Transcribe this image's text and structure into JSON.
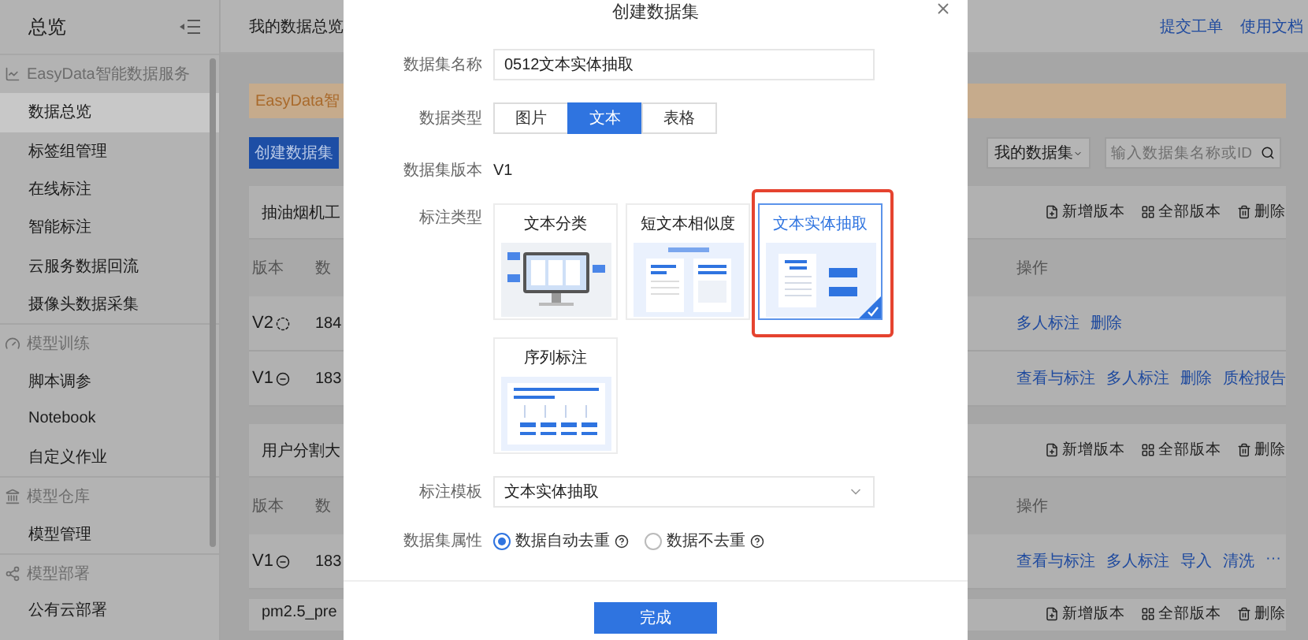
{
  "sidebar": {
    "title": "总览",
    "groups": [
      {
        "label": "EasyData智能数据服务",
        "items": [
          {
            "label": "数据总览",
            "selected": true
          },
          {
            "label": "标签组管理",
            "selected": false
          },
          {
            "label": "在线标注",
            "selected": false
          },
          {
            "label": "智能标注",
            "selected": false
          },
          {
            "label": "云服务数据回流",
            "selected": false
          },
          {
            "label": "摄像头数据采集",
            "selected": false
          }
        ]
      },
      {
        "label": "模型训练",
        "items": [
          {
            "label": "脚本调参",
            "selected": false
          },
          {
            "label": "Notebook",
            "selected": false
          },
          {
            "label": "自定义作业",
            "selected": false
          }
        ]
      },
      {
        "label": "模型仓库",
        "items": [
          {
            "label": "模型管理",
            "selected": false
          }
        ]
      },
      {
        "label": "模型部署",
        "items": [
          {
            "label": "公有云部署",
            "selected": false
          }
        ]
      }
    ]
  },
  "topbar": {
    "title": "我的数据总览",
    "links": [
      "提交工单",
      "使用文档"
    ]
  },
  "banner": {
    "text": "EasyData智"
  },
  "create_button": "创建数据集",
  "filter": {
    "dropdown": "我的数据集",
    "search_placeholder": "输入数据集名称或ID"
  },
  "datasets": [
    {
      "name": "抽油烟机工",
      "actions": [
        "新增版本",
        "全部版本",
        "删除"
      ],
      "columns": [
        "版本",
        "数",
        "操作"
      ],
      "rows": [
        {
          "version": "V2",
          "kind": "pending",
          "count": "184",
          "operations": [
            "多人标注",
            "删除"
          ]
        },
        {
          "version": "V1",
          "kind": "done",
          "count": "183",
          "operations": [
            "查看与标注",
            "多人标注",
            "删除",
            "质检报告"
          ]
        }
      ]
    },
    {
      "name": "用户分割大",
      "actions": [
        "新增版本",
        "全部版本",
        "删除"
      ],
      "columns": [
        "版本",
        "数",
        "操作"
      ],
      "rows": [
        {
          "version": "V1",
          "kind": "done",
          "count": "183",
          "operations": [
            "查看与标注",
            "多人标注",
            "导入",
            "清洗",
            "···"
          ]
        }
      ]
    },
    {
      "name": "pm2.5_pre",
      "actions": [
        "新增版本",
        "全部版本",
        "删除"
      ]
    }
  ],
  "dialog": {
    "title": "创建数据集",
    "name": {
      "label": "数据集名称",
      "value": "0512文本实体抽取"
    },
    "data_type": {
      "label": "数据类型",
      "options": [
        {
          "label": "图片",
          "selected": false
        },
        {
          "label": "文本",
          "selected": true
        },
        {
          "label": "表格",
          "selected": false
        }
      ]
    },
    "version": {
      "label": "数据集版本",
      "value": "V1"
    },
    "annotation_type": {
      "label": "标注类型",
      "options": [
        {
          "label": "文本分类",
          "kind": "classify",
          "selected": false,
          "highlighted": false
        },
        {
          "label": "短文本相似度",
          "kind": "similarity",
          "selected": false,
          "highlighted": false
        },
        {
          "label": "文本实体抽取",
          "kind": "entity",
          "selected": true,
          "highlighted": true
        },
        {
          "label": "序列标注",
          "kind": "sequence",
          "selected": false,
          "highlighted": false
        }
      ]
    },
    "template": {
      "label": "标注模板",
      "value": "文本实体抽取"
    },
    "attribute": {
      "label": "数据集属性",
      "options": [
        {
          "label": "数据自动去重",
          "selected": true
        },
        {
          "label": "数据不去重",
          "selected": false
        }
      ]
    },
    "submit": "完成"
  }
}
